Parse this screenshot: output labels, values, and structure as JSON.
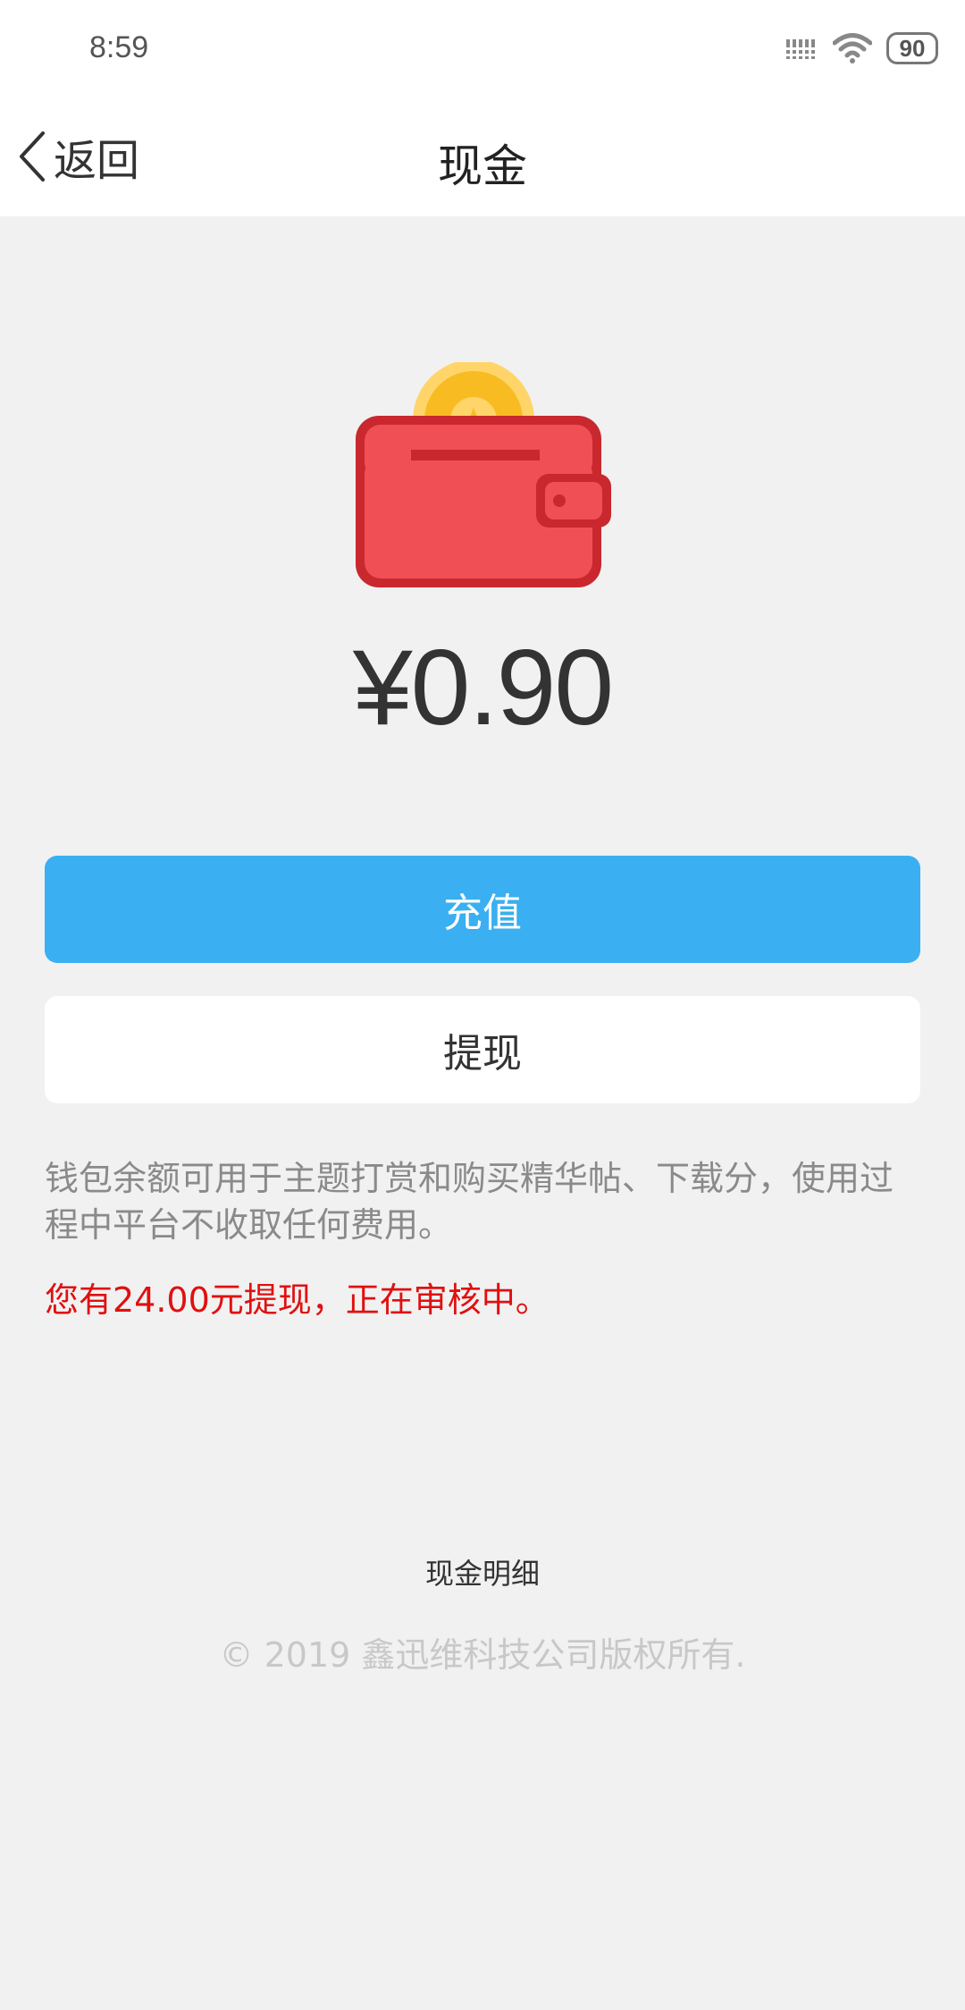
{
  "status_bar": {
    "time": "8:59",
    "battery": "90",
    "signal_icon": "signal-icon",
    "wifi_icon": "wifi-icon"
  },
  "nav": {
    "back_label": "返回",
    "title": "现金"
  },
  "wallet": {
    "balance": "¥0.90",
    "icon": "wallet-coin-icon",
    "colors": {
      "wallet_body": "#f05055",
      "wallet_border": "#c8282e",
      "coin_outer": "#ffd56a",
      "coin_inner": "#f8bb22"
    }
  },
  "actions": {
    "recharge_label": "充值",
    "withdraw_label": "提现",
    "recharge_color": "#3aaff1"
  },
  "info": {
    "description": "钱包余额可用于主题打赏和购买精华帖、下载分，使用过程中平台不收取任何费用。",
    "pending_notice": "您有24.00元提现，正在审核中。",
    "notice_color": "#e01010"
  },
  "footer": {
    "detail_link": "现金明细",
    "copyright": "© 2019 鑫迅维科技公司版权所有."
  }
}
